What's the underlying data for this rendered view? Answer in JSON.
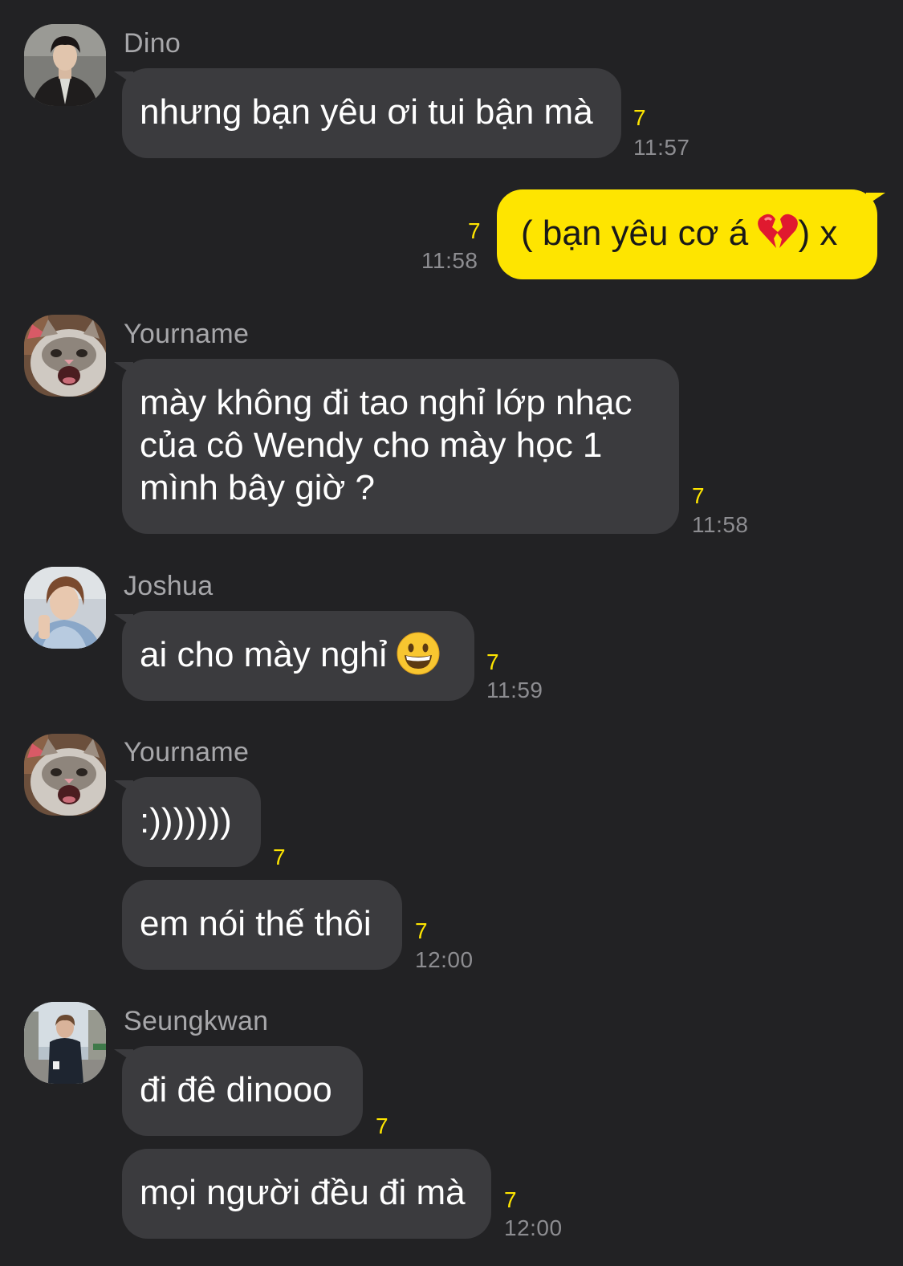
{
  "messages": [
    {
      "sender": "Dino",
      "lines": [
        "nhưng bạn yêu ơi tui bận mà"
      ],
      "unread": "7",
      "time": "11:57"
    },
    {
      "mine": true,
      "text_before": "( bạn yêu cơ á ",
      "emoji": "broken-heart-emoji",
      "text_after": ") x",
      "unread": "7",
      "time": "11:58"
    },
    {
      "sender": "Yourname",
      "lines": [
        "mày không đi tao nghỉ lớp nhạc",
        "của cô Wendy cho mày học 1",
        "mình bây giờ ?"
      ],
      "unread": "7",
      "time": "11:58"
    },
    {
      "sender": "Joshua",
      "text_before": "ai cho mày nghỉ ",
      "emoji": "grinning-face-emoji",
      "unread": "7",
      "time": "11:59"
    },
    {
      "sender": "Yourname",
      "lines": [
        ":)))))))"
      ],
      "unread": "7"
    },
    {
      "lines": [
        "em nói thế thôi"
      ],
      "unread": "7",
      "time": "12:00"
    },
    {
      "sender": "Seungkwan",
      "lines": [
        "đi đê dinooo"
      ],
      "unread": "7"
    },
    {
      "lines": [
        "mọi người đều đi mà"
      ],
      "unread": "7",
      "time": "12:00"
    }
  ],
  "colors": {
    "background": "#222224",
    "bubble_other": "#3b3b3e",
    "bubble_mine": "#fee500",
    "unread": "#fee500",
    "time": "#8d8d91"
  }
}
